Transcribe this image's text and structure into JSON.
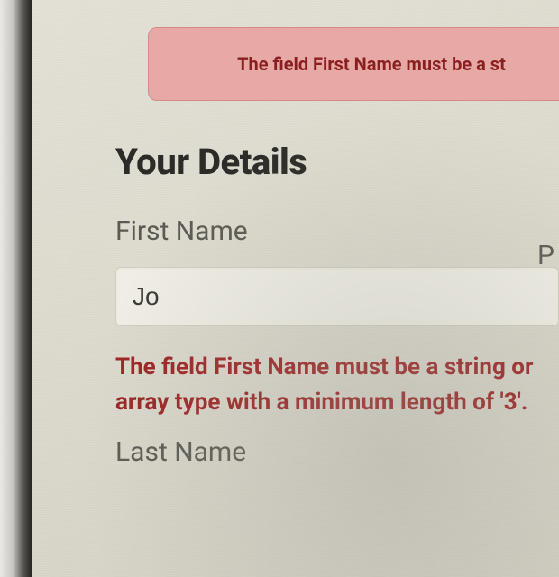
{
  "alert": {
    "text": "The field First Name must be a st"
  },
  "section": {
    "title": "Your Details"
  },
  "form": {
    "first_name": {
      "label": "First Name",
      "value": "Jo",
      "error": "The field First Name must be a string or array type with a minimum length of '3'."
    },
    "last_name": {
      "label": "Last Name"
    },
    "second_column": {
      "label_partial": "P"
    }
  },
  "colors": {
    "alert_bg": "#e7a9a5",
    "alert_text": "#8a1f1f",
    "error_text": "#9b2424",
    "heading": "#2d2b27",
    "label": "#5b5953",
    "input_bg": "#efede4"
  }
}
